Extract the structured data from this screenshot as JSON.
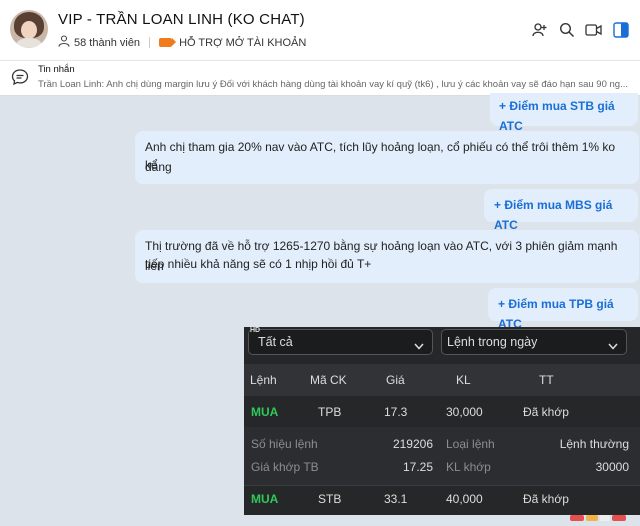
{
  "header": {
    "title": "VIP - TRẦN LOAN LINH (KO CHAT)",
    "members": "58 thành viên",
    "support": "HỖ TRỢ MỞ TÀI KHOẢN"
  },
  "pinned": {
    "label": "Tin nhắn",
    "text": "Trần Loan Linh: Anh chị dùng margin lưu ý  Đối với khách hàng dùng tài khoản vay kí quỹ (tk6) , lưu ý các khoản vay sẽ đáo hạn sau 90 ng..."
  },
  "messages": {
    "m1": "+ Điểm mua STB giá ATC",
    "m2_line1": "Anh chị tham gia 20% nav vào ATC, tích lũy hoảng loạn, cổ phiếu có thể trôi thêm 1% ko đáng",
    "m2_line2": "kể",
    "m3": "+ Điểm mua MBS giá ATC",
    "m4_line1": "Thị trường đã về hỗ trợ 1265-1270 bằng sự hoảng loạn vào ATC, với 3 phiên giảm mạnh liên",
    "m4_line2": "tiếp nhiều khả năng sẽ có 1 nhịp hồi đủ T+",
    "m5": "+ Điểm mua TPB giá ATC"
  },
  "orders": {
    "badge": "HD",
    "filter_all": "Tất cả",
    "filter_period": "Lệnh trong ngày",
    "columns": [
      "Lệnh",
      "Mã CK",
      "Giá",
      "KL",
      "TT"
    ],
    "row1": {
      "side": "MUA",
      "symbol": "TPB",
      "price": "17.3",
      "qty": "30,000",
      "status": "Đã khớp"
    },
    "detail": {
      "order_no_label": "Số hiệu lệnh",
      "order_no": "219206",
      "order_type_label": "Loại lệnh",
      "order_type": "Lệnh thường",
      "avg_price_label": "Giá khớp TB",
      "avg_price": "17.25",
      "matched_qty_label": "KL khớp",
      "matched_qty": "30000"
    },
    "row2": {
      "side": "MUA",
      "symbol": "STB",
      "price": "33.1",
      "qty": "40,000",
      "status": "Đã khớp"
    }
  },
  "colors": {
    "accent": "#1a6fd6",
    "buy": "#2ec95a",
    "bubble": "#e3eefc",
    "panel": "#262729"
  },
  "icons": [
    "people-icon",
    "tag-icon",
    "add-member-icon",
    "search-icon",
    "video-call-icon",
    "sidebar-toggle-icon",
    "chat-icon",
    "chevron-down-icon"
  ]
}
